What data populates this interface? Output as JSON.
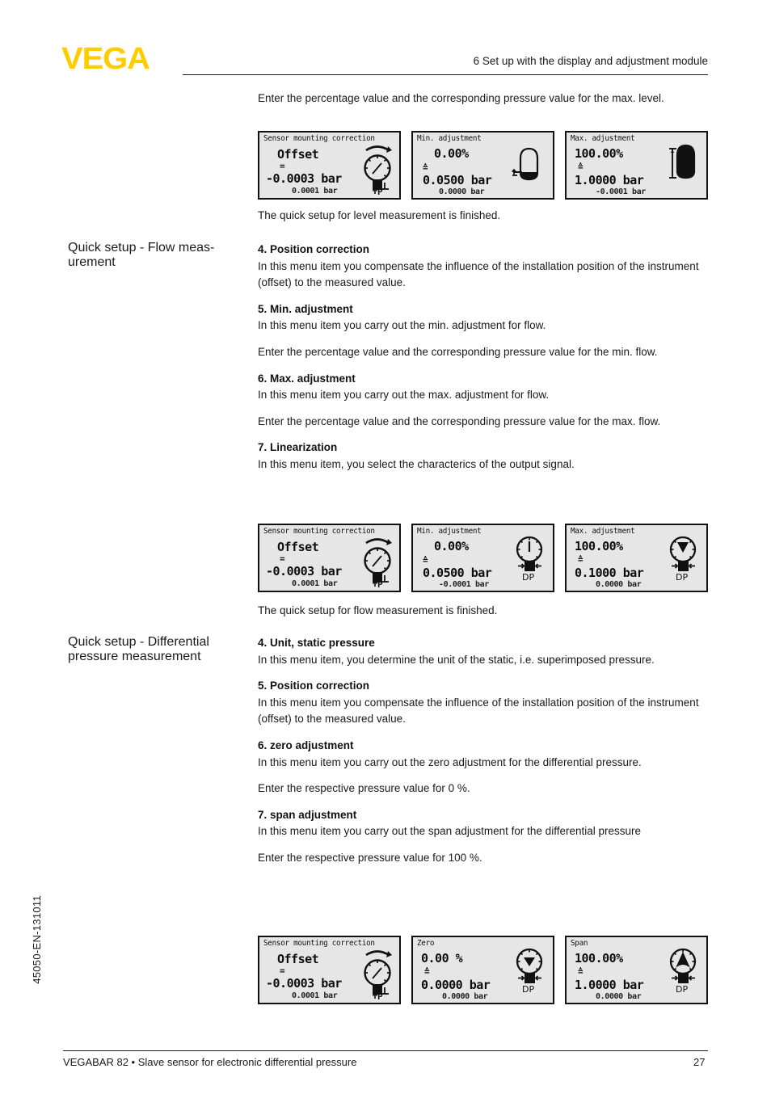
{
  "header": {
    "logo_text": "VEGA",
    "logo_color": "#FFCC00",
    "chapter_title": "6 Set up with the display and adjustment module"
  },
  "intro": {
    "para1": "Enter the percentage value and the corresponding pressure value for the max. level.",
    "finished_level": "The quick setup for level measurement is finished."
  },
  "sections": [
    {
      "margin_title": "Quick setup - Flow meas-\nurement",
      "items": [
        {
          "heading": "4. Position correction",
          "body": "In this menu item you compensate the influence of the installation position of the instrument (offset) to the measured value."
        },
        {
          "heading": "5. Min. adjustment",
          "body": "In this menu item you carry out the min. adjustment for flow.",
          "body2": "Enter the percentage value and the corresponding pressure value for the min. flow."
        },
        {
          "heading": "6. Max. adjustment",
          "body": "In this menu item you carry out the max. adjustment for flow.",
          "body2": "Enter the percentage value and the corresponding pressure value for the max. flow."
        },
        {
          "heading": "7. Linearization",
          "body": "In this menu item, you select the characterics of the output signal."
        }
      ],
      "finished": "The quick setup for flow measurement is finished."
    },
    {
      "margin_title": "Quick setup - Differential\npressure measurement",
      "items": [
        {
          "heading": "4. Unit, static pressure",
          "body": "In this menu item, you determine the unit of the static, i.e. superimposed pressure."
        },
        {
          "heading": "5. Position correction",
          "body": "In this menu item you compensate the influence of the installation position of the instrument (offset) to the measured value."
        },
        {
          "heading": "6. zero adjustment",
          "body": "In this menu item you carry out the zero adjustment for the differential pressure.",
          "body2": "Enter the respective pressure value for 0 %."
        },
        {
          "heading": "7. span adjustment",
          "body": "In this menu item you carry out the span adjustment for the differential pressure",
          "body2": "Enter the respective pressure value for 100 %."
        }
      ]
    }
  ],
  "screens": {
    "level": [
      {
        "title": "Sensor mounting correction",
        "label": "Offset",
        "equals": "=",
        "value": "-0.0003 bar",
        "subvalue": "0.0001 bar",
        "icon": "pressure-gauge-offset-icon"
      },
      {
        "title": "Min. adjustment",
        "percent": "0.00%",
        "corresponds": "≙",
        "value": "0.0500 bar",
        "subvalue": "0.0000 bar",
        "icon": "tank-empty-icon"
      },
      {
        "title": "Max. adjustment",
        "percent": "100.00%",
        "corresponds": "≙",
        "value": "1.0000 bar",
        "subvalue": "-0.0001 bar",
        "icon": "tank-full-icon"
      }
    ],
    "flow": [
      {
        "title": "Sensor mounting correction",
        "label": "Offset",
        "equals": "=",
        "value": "-0.0003 bar",
        "subvalue": "0.0001 bar",
        "icon": "pressure-gauge-offset-icon"
      },
      {
        "title": "Min. adjustment",
        "percent": "0.00%",
        "corresponds": "≙",
        "value": "0.0500 bar",
        "subvalue": "-0.0001 bar",
        "icon": "dp-gauge-min-icon",
        "icon_label": "DP"
      },
      {
        "title": "Max. adjustment",
        "percent": "100.00%",
        "corresponds": "≙",
        "value": "0.1000 bar",
        "subvalue": "0.0000 bar",
        "icon": "dp-gauge-max-icon",
        "icon_label": "DP"
      }
    ],
    "differential": [
      {
        "title": "Sensor mounting correction",
        "label": "Offset",
        "equals": "=",
        "value": "-0.0003 bar",
        "subvalue": "0.0001 bar",
        "icon": "pressure-gauge-offset-icon"
      },
      {
        "title": "Zero",
        "percent": "0.00 %",
        "corresponds": "≙",
        "value": "0.0000 bar",
        "subvalue": "0.0000 bar",
        "icon": "dp-gauge-zero-icon",
        "icon_label": "DP"
      },
      {
        "title": "Span",
        "percent": "100.00%",
        "corresponds": "≙",
        "value": "1.0000 bar",
        "subvalue": "0.0000 bar",
        "icon": "dp-gauge-span-icon",
        "icon_label": "DP"
      }
    ]
  },
  "footer": {
    "doc_id": "45050-EN-131011",
    "product_line": "VEGABAR 82 • Slave sensor for electronic differential pressure",
    "page_number": "27"
  }
}
